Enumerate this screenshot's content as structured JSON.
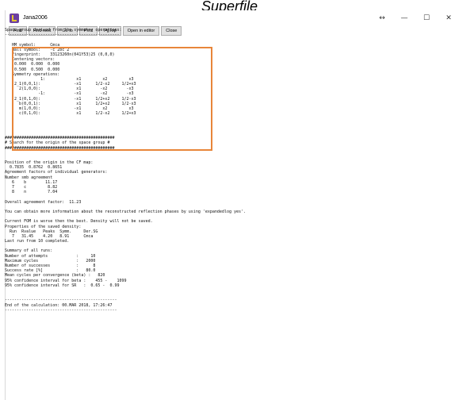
{
  "caption": "Superfile",
  "window": {
    "title": "Jana2006",
    "controls": [
      "↔",
      "—",
      "☐",
      "✕"
    ]
  },
  "toolbar": {
    "buttons": [
      "Find",
      "Find next",
      "Go to",
      "Print",
      "PgTop",
      "Open in editor",
      "Close"
    ]
  },
  "output_lines": [
    "Space group derived from the symmetry operations:",
    "------------------------------------------------",
    "",
    "   HM symbol:      Cmca",
    "   Hall symbol:    -c 2bc 2",
    "   Fingerprint:    33123260n(041Y53)25 (0,0,0)",
    "   Centering vectors:",
    "    0.000  0.000  0.000",
    "    0.500  0.500  0.000",
    "   Symmetry operations:",
    "               1:             x1         x2         x3",
    "    2_1(0,0,1):              -x1      1/2-x2     1/2+x3",
    "      2(1,0,0):               x1        -x2        -x3",
    "              -1:            -x1        -x2        -x3",
    "    2_1(0,1,0):              -x1      1/2+x2     1/2-x3",
    "      b(0,0,1):               x1      1/2+x2     1/2-x3",
    "      m(1,0,0):              -x1         x2         x3",
    "      c(0,1,0):               x1      1/2-x2     1/2+x3",
    "",
    "",
    "",
    "",
    "##############################################",
    "# Search for the origin of the space group #",
    "##############################################",
    "",
    "",
    "Position of the origin in the CF map:",
    "  0.7835  0.8762  0.8651",
    "Agreement factors of individual generators:",
    "Number smb agreement",
    "   6    b        11.17",
    "   7    c         8.82",
    "   8    n         7.04",
    "",
    "Overall agreement factor:  11.23",
    "",
    "You can obtain more information about the reconstructed reflection phases by using 'expandedlog yes'.",
    "",
    "Current FOM is worse then the best. Density will not be saved.",
    "Properties of the saved density:",
    "  Run  Rvalue   Peaks  Symm.     Der.SG",
    "   7   31.45    4.20   8.91      Cmca",
    "Last run from 10 completed.",
    "",
    "Summary of all runs:",
    "Number of attempts            :     10",
    "Maximum cycles                :   2000",
    "Number of successes           :      8",
    "Success rate [%]              :   80.0",
    "Mean cycles per convergence (beta) :   820",
    "95% confidence interval for beta :    455 -    1099",
    "95% confidence interval for SR   :  0.65 -  0.99",
    "",
    "",
    "-----------------------------------------------",
    "End of the calculation: 00.MAR 2018, 17:26:47",
    "-----------------------------------------------"
  ]
}
